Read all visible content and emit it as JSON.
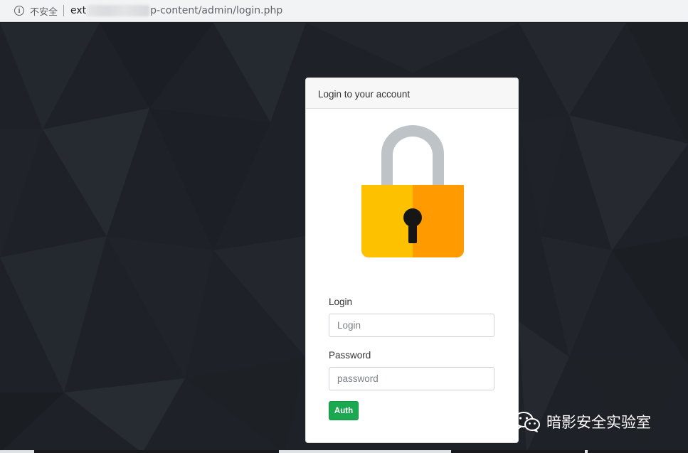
{
  "browser": {
    "security_label": "不安全",
    "url_host_visible": "ext",
    "url_path_visible": "p-content/admin/login.php",
    "icon": "info-icon"
  },
  "card": {
    "title": "Login to your account",
    "lock_icon": "padlock-icon",
    "login_label": "Login",
    "login_placeholder": "Login",
    "login_value": "",
    "password_label": "Password",
    "password_placeholder": "password",
    "password_value": "",
    "auth_button": "Auth"
  },
  "watermark": {
    "text": "暗影安全实验室",
    "icon": "wechat-icon"
  },
  "colors": {
    "background": "#1e2228",
    "button": "#1aa851",
    "lock_body_left": "#fdc100",
    "lock_body_right": "#ff9b00",
    "lock_shackle": "#bdc3c7"
  }
}
